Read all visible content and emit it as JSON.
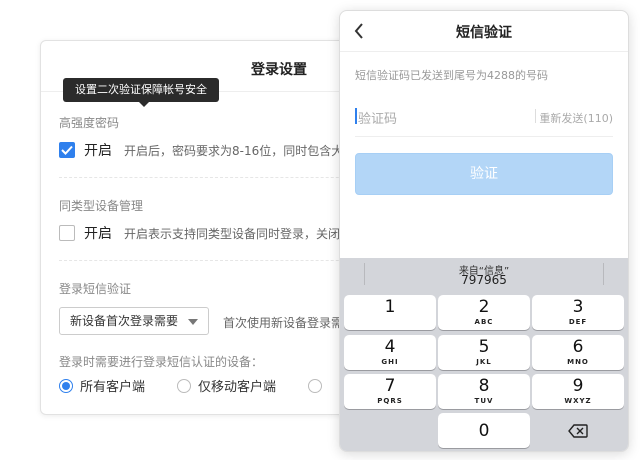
{
  "settings": {
    "title": "登录设置",
    "tooltip": "设置二次验证保障帐号安全",
    "section1": {
      "heading": "高强度密码",
      "toggle_label": "开启",
      "checked": true,
      "desc": "开启后，密码要求为8-16位，同时包含大"
    },
    "section2": {
      "heading": "同类型设备管理",
      "toggle_label": "开启",
      "checked": false,
      "desc": "开启表示支持同类型设备同时登录，关闭"
    },
    "section3": {
      "heading": "登录短信验证",
      "select_value": "新设备首次登录需要",
      "select_desc": "首次使用新设备登录需",
      "devices_question": "登录时需要进行登录短信认证的设备：",
      "options": [
        "所有客户端",
        "仅移动客户端"
      ],
      "selected_option": "所有客户端"
    }
  },
  "phone": {
    "title": "短信验证",
    "hint": "短信验证码已发送到尾号为4288的号码",
    "code_placeholder": "验证码",
    "resend": "重新发送(110)",
    "verify_button": "验证",
    "icons": {
      "back": "chevron-left-icon",
      "delete": "backspace-icon"
    },
    "keyboard": {
      "suggestion_source": "来自“信息”",
      "suggestion_code": "797965",
      "keys": [
        {
          "digit": "1",
          "letters": ""
        },
        {
          "digit": "2",
          "letters": "ABC"
        },
        {
          "digit": "3",
          "letters": "DEF"
        },
        {
          "digit": "4",
          "letters": "GHI"
        },
        {
          "digit": "5",
          "letters": "JKL"
        },
        {
          "digit": "6",
          "letters": "MNO"
        },
        {
          "digit": "7",
          "letters": "PQRS"
        },
        {
          "digit": "8",
          "letters": "TUV"
        },
        {
          "digit": "9",
          "letters": "WXYZ"
        },
        {
          "digit": "0",
          "letters": ""
        }
      ]
    }
  },
  "colors": {
    "accent": "#2f80ed",
    "verify_disabled": "#b3d6f7",
    "keyboard_bg": "#d3d5da"
  }
}
